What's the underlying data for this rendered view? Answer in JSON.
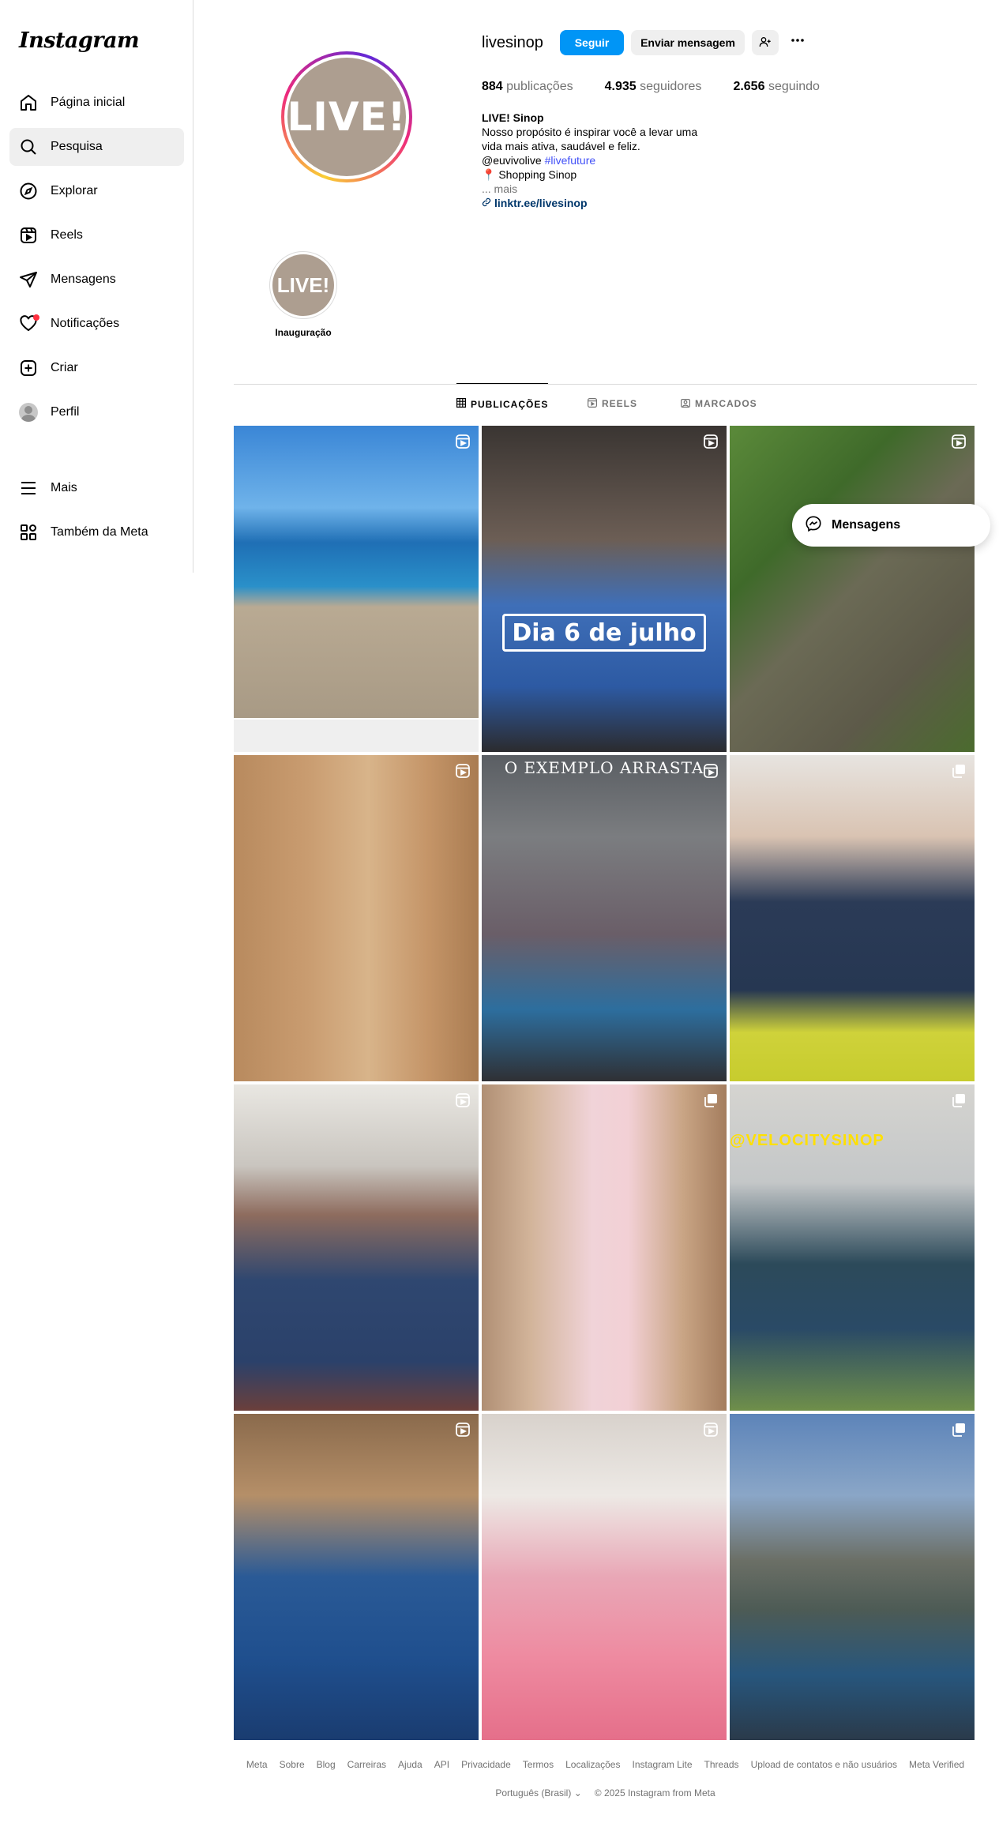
{
  "app": {
    "logo": "Instagram"
  },
  "sidebar": {
    "items": [
      {
        "label": "Página inicial",
        "icon": "home-icon"
      },
      {
        "label": "Pesquisa",
        "icon": "search-icon"
      },
      {
        "label": "Explorar",
        "icon": "compass-icon"
      },
      {
        "label": "Reels",
        "icon": "reels-icon"
      },
      {
        "label": "Mensagens",
        "icon": "send-icon"
      },
      {
        "label": "Notificações",
        "icon": "heart-icon"
      },
      {
        "label": "Criar",
        "icon": "plus-square-icon"
      },
      {
        "label": "Perfil",
        "icon": "avatar"
      },
      {
        "label": "Mais",
        "icon": "menu-icon"
      },
      {
        "label": "Também da Meta",
        "icon": "meta-apps-icon"
      }
    ],
    "active_index": 1
  },
  "profile": {
    "username": "livesinop",
    "avatar_text": "LIVE!",
    "follow_label": "Seguir",
    "message_label": "Enviar mensagem",
    "stats": {
      "posts_value": "884",
      "posts_label": "publicações",
      "followers_value": "4.935",
      "followers_label": "seguidores",
      "following_value": "2.656",
      "following_label": "seguindo"
    },
    "bio": {
      "name": "LIVE! Sinop",
      "line1": "Nosso propósito é inspirar você a levar uma",
      "line2": "vida mais ativa, saudável e feliz.",
      "mention": "@euvivolive",
      "hashtag": "#livefuture",
      "location_emoji": "📍",
      "location": "Shopping Sinop",
      "more": "... mais",
      "link": "linktr.ee/livesinop"
    }
  },
  "highlights": [
    {
      "label": "Inauguração",
      "cover_text": "LIVE!"
    }
  ],
  "tabs": [
    {
      "label": "PUBLICAÇÕES",
      "icon": "grid-icon",
      "active": true
    },
    {
      "label": "REELS",
      "icon": "reels-icon",
      "active": false
    },
    {
      "label": "MARCADOS",
      "icon": "tagged-icon",
      "active": false
    }
  ],
  "posts": [
    {
      "type": "reel",
      "overlay": ""
    },
    {
      "type": "reel",
      "overlay": "Dia 6 de julho"
    },
    {
      "type": "reel",
      "overlay": ""
    },
    {
      "type": "reel",
      "overlay": ""
    },
    {
      "type": "reel",
      "overlay": "O EXEMPLO ARRASTA"
    },
    {
      "type": "carousel",
      "overlay": ""
    },
    {
      "type": "reel",
      "overlay": ""
    },
    {
      "type": "carousel",
      "overlay": ""
    },
    {
      "type": "carousel",
      "overlay": "@VELOCITYSINOP"
    },
    {
      "type": "reel",
      "overlay": ""
    },
    {
      "type": "reel",
      "overlay": ""
    },
    {
      "type": "carousel",
      "overlay": ""
    }
  ],
  "floating": {
    "messages_label": "Mensagens"
  },
  "footer": {
    "links": [
      "Meta",
      "Sobre",
      "Blog",
      "Carreiras",
      "Ajuda",
      "API",
      "Privacidade",
      "Termos",
      "Localizações",
      "Instagram Lite",
      "Threads",
      "Upload de contatos e não usuários",
      "Meta Verified"
    ],
    "language": "Português (Brasil)",
    "copyright": "© 2025 Instagram from Meta"
  },
  "colors": {
    "accent": "#0095f6",
    "notification": "#ff3040",
    "brand_tan": "#ad9e90"
  }
}
